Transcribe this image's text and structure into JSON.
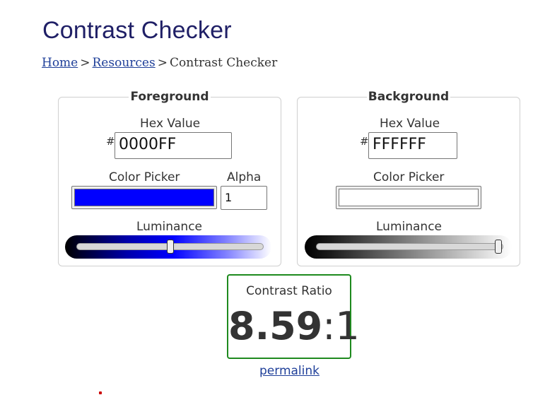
{
  "page": {
    "title": "Contrast Checker"
  },
  "breadcrumb": {
    "home": "Home",
    "resources": "Resources",
    "current": "Contrast Checker",
    "separator": ">"
  },
  "foreground": {
    "legend": "Foreground",
    "hex_label": "Hex Value",
    "hash": "#",
    "hex_value": "0000FF",
    "picker_label": "Color Picker",
    "picker_color": "#0000ff",
    "alpha_label": "Alpha",
    "alpha_value": "1",
    "luminance_label": "Luminance",
    "luminance_level": 0.5
  },
  "background": {
    "legend": "Background",
    "hex_label": "Hex Value",
    "hash": "#",
    "hex_value": "FFFFFF",
    "picker_label": "Color Picker",
    "picker_color": "#ffffff",
    "luminance_label": "Luminance",
    "luminance_level": 1.0
  },
  "result": {
    "label": "Contrast Ratio",
    "ratio_number": "8.59",
    "ratio_suffix": ":1",
    "permalink": "permalink",
    "pass_color": "#1e8a1e"
  },
  "colors": {
    "title": "#1f1f66",
    "link": "#1f3f99"
  }
}
